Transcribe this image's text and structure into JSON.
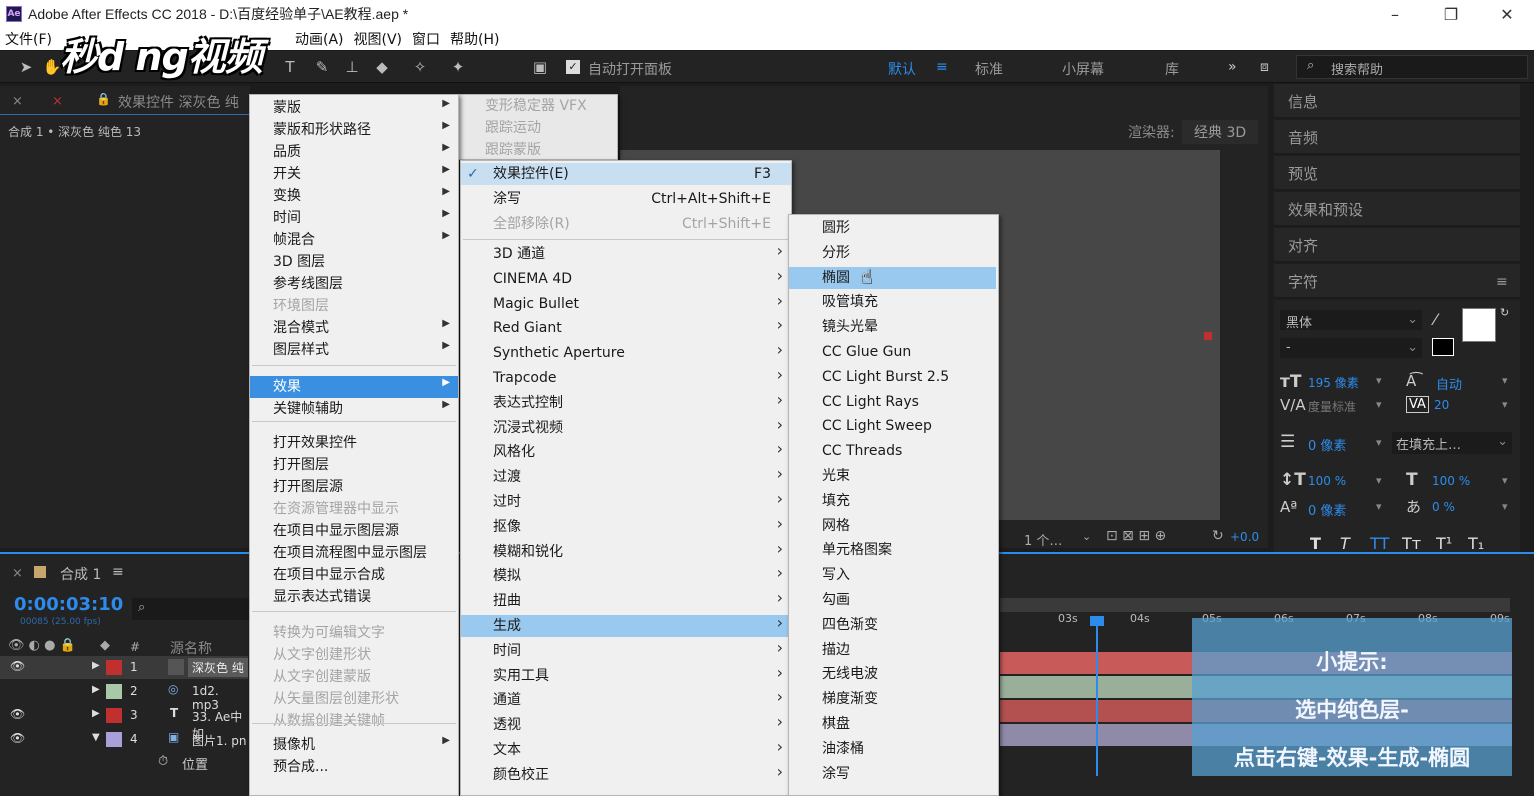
{
  "window": {
    "title": "Adobe After Effects CC 2018 - D:\\百度经验单子\\AE教程.aep *",
    "logo": "Ae"
  },
  "menubar": [
    "文件(F)",
    "动画(A)",
    "视图(V)",
    "窗口",
    "帮助(H)"
  ],
  "watermark": "秒d ng视频",
  "toolbar": {
    "auto_open_panel": "自动打开面板",
    "workspaces": [
      "默认",
      "标准",
      "小屏幕",
      "库"
    ],
    "more": "»",
    "search_placeholder": "搜索帮助"
  },
  "effect_panel": {
    "tab_label": "效果控件 深灰色 纯",
    "info": "合成 1 • 深灰色 纯色 13"
  },
  "viewer": {
    "renderer_label": "渲染器:",
    "renderer_value": "经典 3D",
    "view_count": "1 个…",
    "exposure": "+0.0"
  },
  "context_menu": {
    "items": [
      {
        "label": "蒙版",
        "sub": true
      },
      {
        "label": "蒙版和形状路径",
        "sub": true
      },
      {
        "label": "品质",
        "sub": true
      },
      {
        "label": "开关",
        "sub": true
      },
      {
        "label": "变换",
        "sub": true
      },
      {
        "label": "时间",
        "sub": true
      },
      {
        "label": "帧混合",
        "sub": true
      },
      {
        "label": "3D 图层"
      },
      {
        "label": "参考线图层"
      },
      {
        "label": "环境图层",
        "disabled": true
      },
      {
        "label": "混合模式",
        "sub": true
      },
      {
        "label": "图层样式",
        "sub": true
      },
      {
        "label": "效果",
        "sub": true,
        "highlight": true
      },
      {
        "label": "关键帧辅助",
        "sub": true
      },
      {
        "label": "打开效果控件"
      },
      {
        "label": "打开图层"
      },
      {
        "label": "打开图层源"
      },
      {
        "label": "在资源管理器中显示",
        "disabled": true
      },
      {
        "label": "在项目中显示图层源"
      },
      {
        "label": "在项目流程图中显示图层"
      },
      {
        "label": "在项目中显示合成"
      },
      {
        "label": "显示表达式错误"
      },
      {
        "label": "转换为可编辑文字",
        "disabled": true
      },
      {
        "label": "从文字创建形状",
        "disabled": true
      },
      {
        "label": "从文字创建蒙版",
        "disabled": true
      },
      {
        "label": "从矢量图层创建形状",
        "disabled": true
      },
      {
        "label": "从数据创建关键帧",
        "disabled": true
      },
      {
        "label": "摄像机",
        "sub": true
      },
      {
        "label": "预合成..."
      }
    ]
  },
  "back_menu": [
    "变形稳定器 VFX",
    "跟踪运动",
    "跟踪蒙版"
  ],
  "effects_menu": {
    "top": [
      {
        "label": "效果控件(E)",
        "shortcut": "F3",
        "checked": true
      },
      {
        "label": "涂写",
        "shortcut": "Ctrl+Alt+Shift+E"
      },
      {
        "label": "全部移除(R)",
        "shortcut": "Ctrl+Shift+E",
        "disabled": true
      }
    ],
    "categories": [
      "3D 通道",
      "CINEMA 4D",
      "Magic Bullet",
      "Red Giant",
      "Synthetic Aperture",
      "Trapcode",
      "表达式控制",
      "沉浸式视频",
      "风格化",
      "过渡",
      "过时",
      "抠像",
      "模糊和锐化",
      "模拟",
      "扭曲",
      "生成",
      "时间",
      "实用工具",
      "通道",
      "透视",
      "文本",
      "颜色校正"
    ],
    "highlight": "生成"
  },
  "generate_menu": {
    "items": [
      "圆形",
      "分形",
      "椭圆",
      "吸管填充",
      "镜头光晕",
      "CC Glue Gun",
      "CC Light Burst 2.5",
      "CC Light Rays",
      "CC Light Sweep",
      "CC Threads",
      "光束",
      "填充",
      "网格",
      "单元格图案",
      "写入",
      "勾画",
      "四色渐变",
      "描边",
      "无线电波",
      "梯度渐变",
      "棋盘",
      "油漆桶",
      "涂写"
    ],
    "highlight": "椭圆"
  },
  "right_panels": [
    "信息",
    "音频",
    "预览",
    "效果和预设",
    "对齐",
    "字符"
  ],
  "character": {
    "font": "黑体",
    "style": "-",
    "size": "195 像素",
    "leading": "自动",
    "kerning": "度量标准",
    "tracking": "20",
    "stroke": "0 像素",
    "stroke_mode": "在填充上…",
    "vscale": "100 %",
    "hscale": "100 %",
    "baseline": "0 像素",
    "tsume": "0 %",
    "style_buttons": [
      "T",
      "T",
      "TT",
      "Tт",
      "T¹",
      "T₁"
    ],
    "colors": {
      "fill": "#ffffff",
      "stroke": "#0000aa"
    }
  },
  "timeline": {
    "comp_tab": "合成 1",
    "timecode": "0:00:03:10",
    "fps": "00085 (25.00 fps)",
    "col_source": "源名称",
    "layers": [
      {
        "num": "1",
        "name": "深灰色 纯",
        "color": "#c03030",
        "type": "solid"
      },
      {
        "num": "2",
        "name": "1d2. mp3",
        "color": "#a8c8a8",
        "type": "audio"
      },
      {
        "num": "3",
        "name": "33. Ae中如",
        "color": "#c03030",
        "type": "text"
      },
      {
        "num": "4",
        "name": "图片1. pn",
        "color": "#a8a0d8",
        "type": "image"
      }
    ],
    "position_label": "位置",
    "ruler_ticks": [
      "03s",
      "04s",
      "05s",
      "06s",
      "07s",
      "08s",
      "09s"
    ]
  },
  "tip": {
    "title": "小提示:",
    "line1": "选中纯色层-",
    "line2": "点击右键-效果-生成-椭圆"
  }
}
